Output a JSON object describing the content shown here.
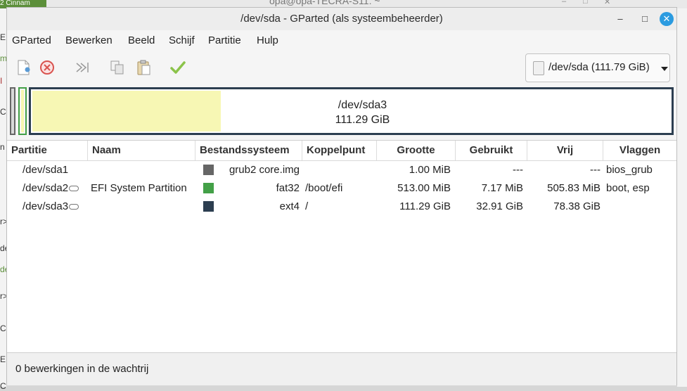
{
  "background": {
    "terminal_title": "opa@opa-TECRA-S11: ~",
    "tab_label": "2 Cinnam",
    "left_fragments": [
      "E",
      "m",
      "I",
      "C",
      "n",
      "r>",
      "de",
      "de",
      "r>",
      "C",
      "E",
      "C"
    ]
  },
  "window": {
    "title": "/dev/sda - GParted (als systeembeheerder)",
    "controls": {
      "minimize": "–",
      "maximize": "□",
      "close": "✕"
    }
  },
  "menu": {
    "items": [
      "GParted",
      "Bewerken",
      "Beeld",
      "Schijf",
      "Partitie",
      "Hulp"
    ]
  },
  "toolbar": {
    "buttons": [
      {
        "name": "new-partition-icon"
      },
      {
        "name": "delete-partition-icon"
      },
      {
        "name": "resize-move-icon"
      },
      {
        "name": "copy-icon"
      },
      {
        "name": "paste-icon"
      },
      {
        "name": "apply-icon"
      }
    ]
  },
  "device_selector": {
    "label": "/dev/sda (111.79 GiB)"
  },
  "disk_map": {
    "selected_name": "/dev/sda3",
    "selected_size": "111.29 GiB",
    "colors": {
      "sda1": "#666666",
      "sda2": "#43a047",
      "sda3": "#2c3e50",
      "used": "#f7f7b4"
    }
  },
  "table": {
    "columns": [
      "Partitie",
      "Naam",
      "Bestandssysteem",
      "Koppelpunt",
      "Grootte",
      "Gebruikt",
      "Vrij",
      "Vlaggen"
    ],
    "rows": [
      {
        "partition": "/dev/sda1",
        "mounted": false,
        "name": "",
        "fs_color": "#666666",
        "filesystem": "grub2 core.img",
        "mountpoint": "",
        "size": "1.00 MiB",
        "used": "---",
        "free": "---",
        "flags": "bios_grub"
      },
      {
        "partition": "/dev/sda2",
        "mounted": true,
        "name": "EFI System Partition",
        "fs_color": "#43a047",
        "filesystem": "fat32",
        "mountpoint": "/boot/efi",
        "size": "513.00 MiB",
        "used": "7.17 MiB",
        "free": "505.83 MiB",
        "flags": "boot, esp"
      },
      {
        "partition": "/dev/sda3",
        "mounted": true,
        "name": "",
        "fs_color": "#2c3e50",
        "filesystem": "ext4",
        "mountpoint": "/",
        "size": "111.29 GiB",
        "used": "32.91 GiB",
        "free": "78.38 GiB",
        "flags": ""
      }
    ]
  },
  "status": {
    "text": "0 bewerkingen in de wachtrij"
  }
}
